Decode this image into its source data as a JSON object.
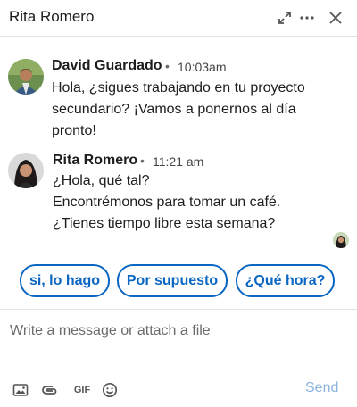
{
  "header": {
    "title": "Rita Romero",
    "icons": [
      "expand-icon",
      "more-icon",
      "close-icon"
    ]
  },
  "messages": [
    {
      "sender": "David Guardado",
      "separator": "•",
      "time": "10:03am",
      "lines": [
        "Hola, ¿sigues trabajando en tu proyecto",
        "secundario? ¡Vamos a ponernos al día",
        "pronto!"
      ]
    },
    {
      "sender": "Rita Romero",
      "separator": "•",
      "time": "11:21 am",
      "lines": [
        "¿Hola, qué tal?",
        "Encontrémonos para tomar un café.",
        "¿Tienes tiempo libre esta semana?"
      ]
    }
  ],
  "quick_replies": [
    "si, lo hago",
    "Por supuesto",
    "¿Qué hora?"
  ],
  "composer": {
    "placeholder": "Write a message or attach a file",
    "tools": {
      "image": "image-icon",
      "attach": "attach-icon",
      "gif": "GIF",
      "emoji": "emoji-icon"
    },
    "send_label": "Send"
  },
  "colors": {
    "accent": "#0a66c2",
    "send_disabled": "#8ab4e0",
    "divider": "#e2e2e2"
  }
}
